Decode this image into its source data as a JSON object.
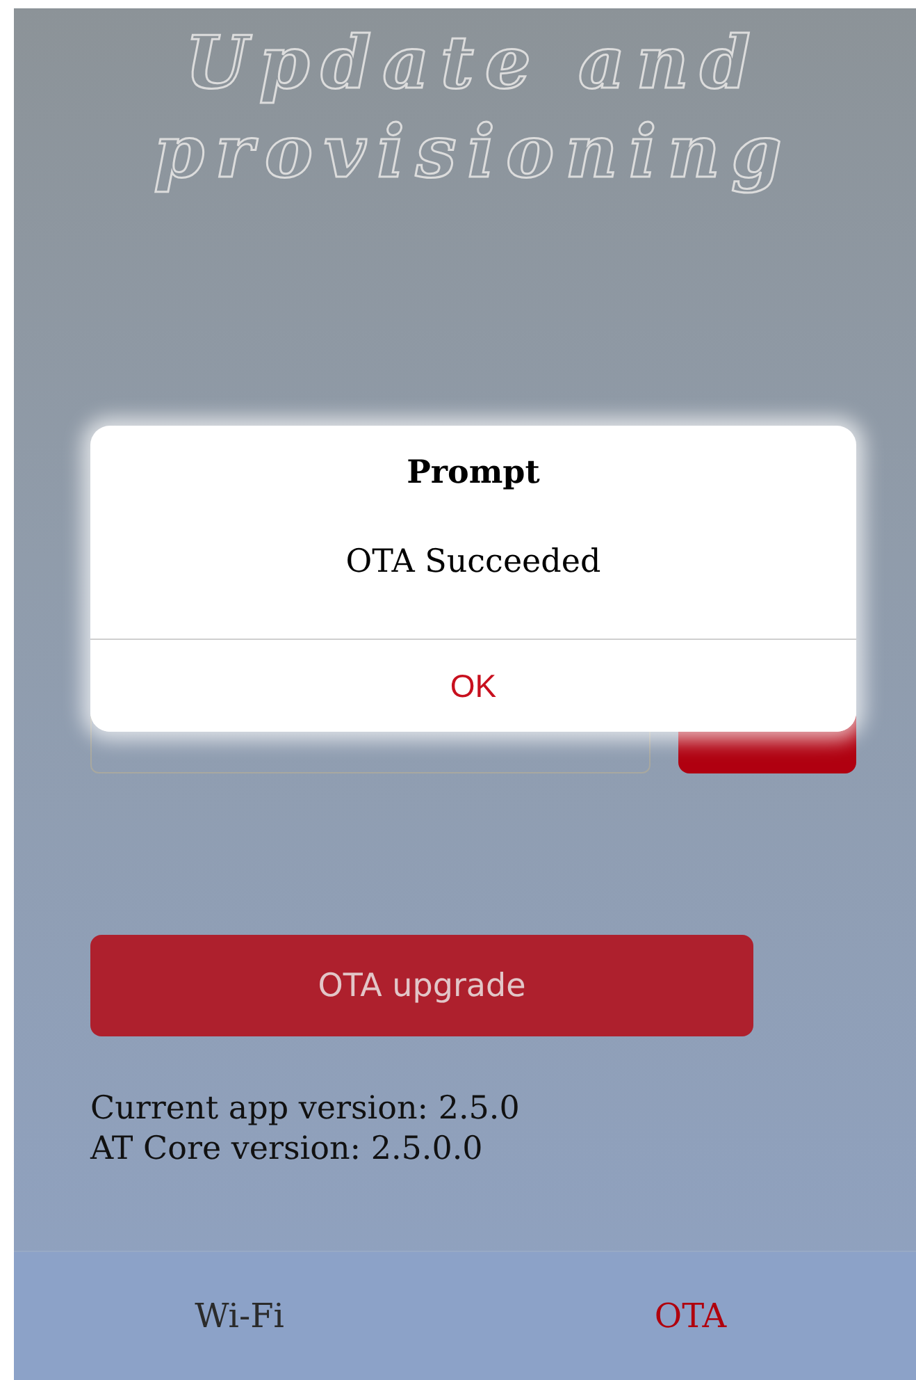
{
  "header": {
    "title": "Update and provisioning"
  },
  "upgrade_button": "OTA upgrade",
  "versions": [
    "Current app version:  2.5.0",
    "AT Core version:  2.5.0.0"
  ],
  "tabs": [
    {
      "label": "Wi-Fi",
      "selected": false
    },
    {
      "label": "OTA",
      "selected": true
    }
  ],
  "dialog": {
    "title": "Prompt",
    "message": "OTA Succeeded",
    "button": "OK"
  }
}
